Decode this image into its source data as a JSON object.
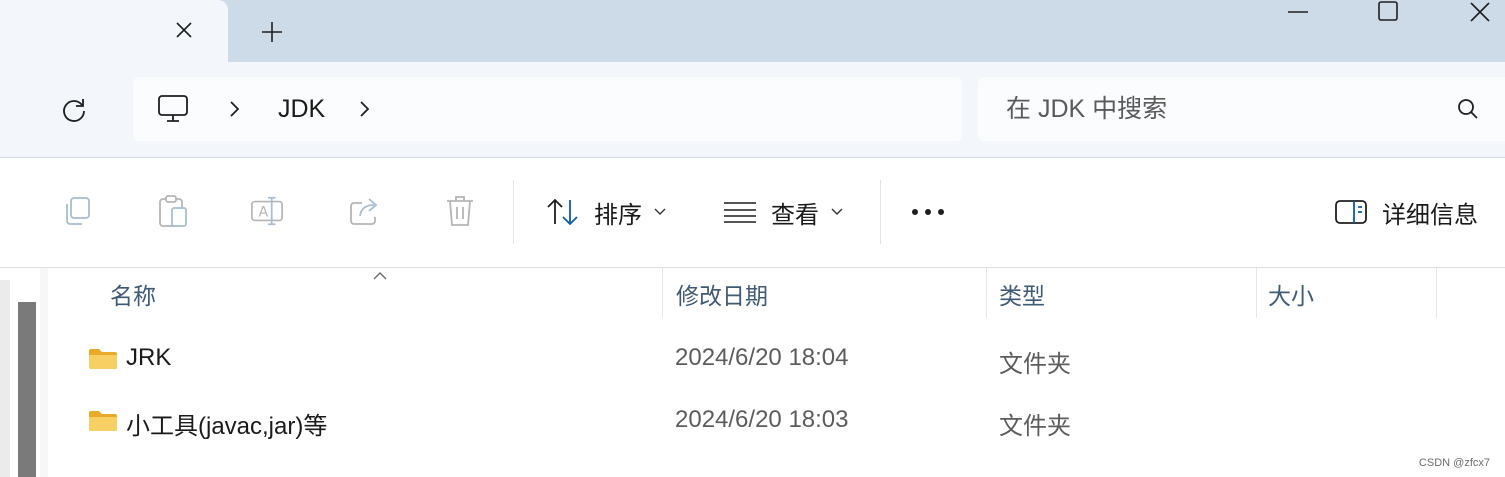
{
  "window": {
    "tab_close_icon": "close-icon",
    "new_tab_icon": "plus-icon",
    "controls": [
      "minimize-icon",
      "maximize-icon",
      "close-icon"
    ]
  },
  "navigation": {
    "refresh_icon": "refresh-icon",
    "breadcrumb": {
      "root_icon": "computer-icon",
      "segments": [
        "JDK"
      ]
    },
    "search": {
      "placeholder": "在 JDK 中搜索",
      "value": ""
    }
  },
  "toolbar": {
    "disabled_actions": [
      "copy-icon",
      "paste-icon",
      "rename-icon",
      "share-icon",
      "delete-icon"
    ],
    "sort_label": "排序",
    "view_label": "查看",
    "more_icon": "more-icon",
    "details_label": "详细信息"
  },
  "file_list": {
    "columns": [
      "名称",
      "修改日期",
      "类型",
      "大小"
    ],
    "rows": [
      {
        "name": "JRK",
        "modified": "2024/6/20 18:04",
        "type": "文件夹",
        "size": "",
        "icon": "folder-icon"
      },
      {
        "name": "小工具(javac,jar)等",
        "modified": "2024/6/20 18:03",
        "type": "文件夹",
        "size": "",
        "icon": "folder-icon"
      }
    ]
  },
  "watermark": "CSDN @zfcx7",
  "colors": {
    "titlebar": "#cddbe9",
    "nav_background": "#f3f6fa",
    "accent": "#0b5cad",
    "folder": "#f6c65a",
    "header_text": "#3f5a75"
  }
}
